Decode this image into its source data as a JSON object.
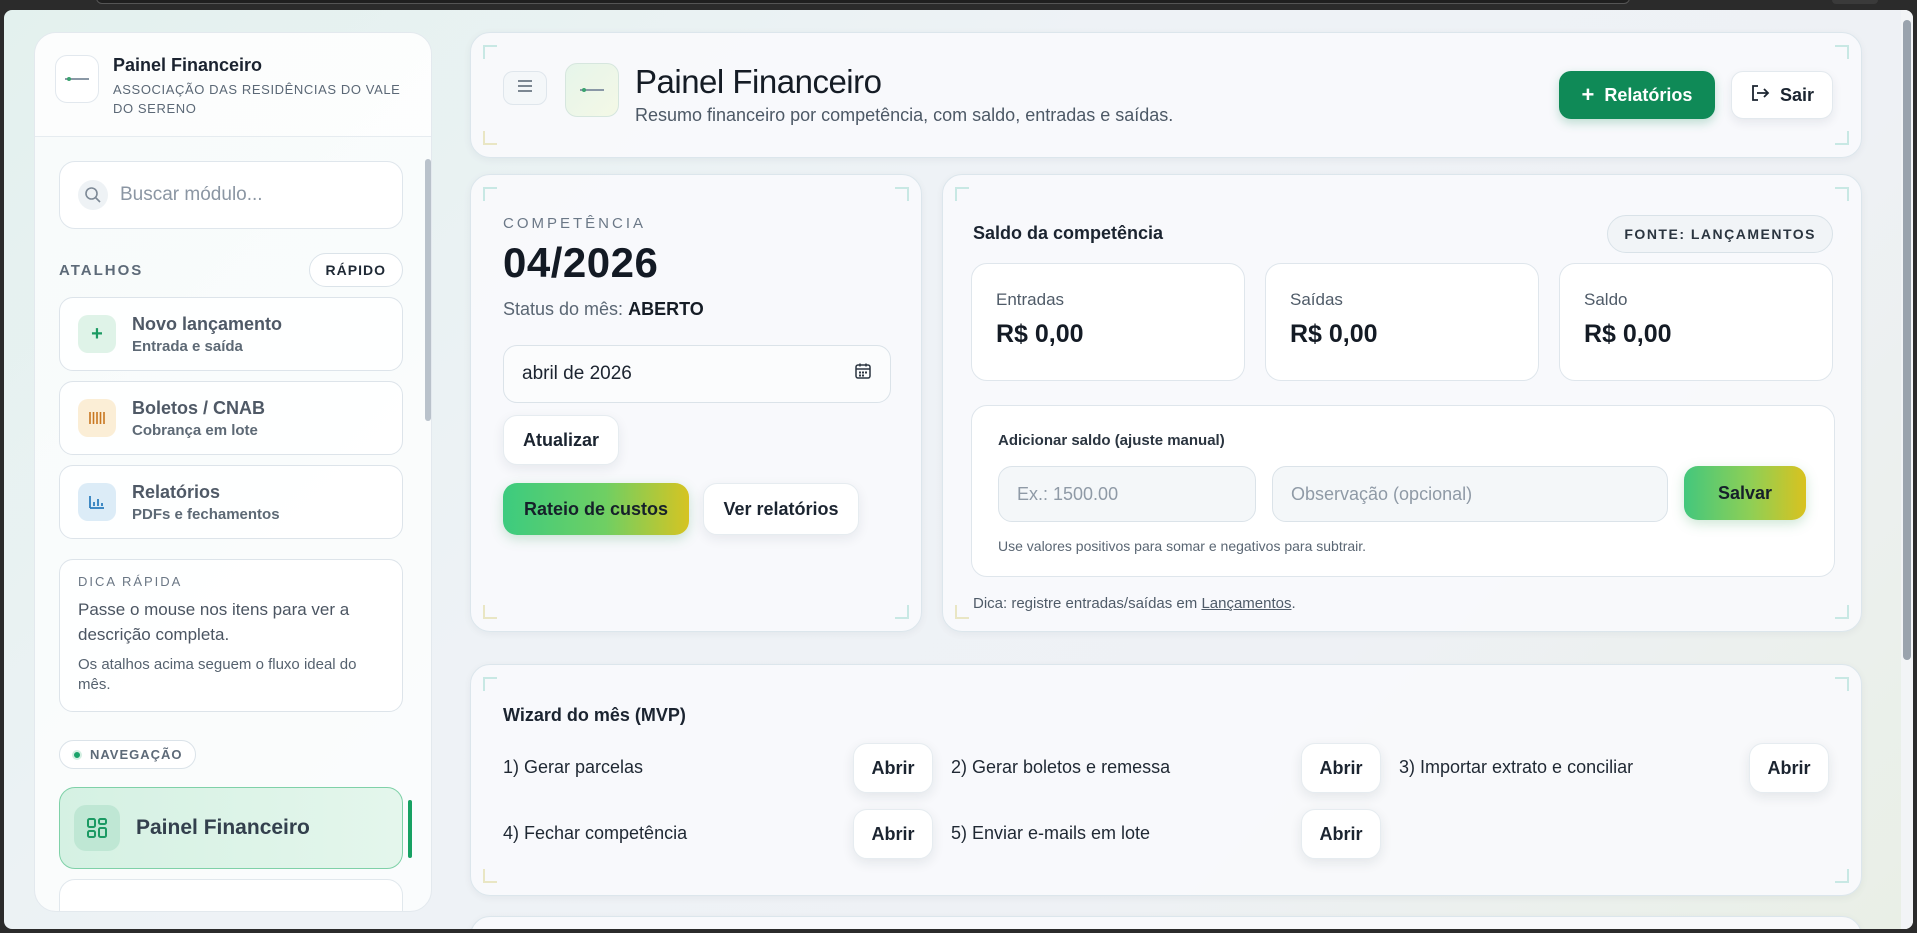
{
  "sidebar": {
    "title": "Painel Financeiro",
    "subtitle": "ASSOCIAÇÃO DAS RESIDÊNCIAS DO VALE DO SERENO",
    "search_placeholder": "Buscar módulo...",
    "shortcuts_label": "ATALHOS",
    "quick_button": "RÁPIDO",
    "shortcuts": [
      {
        "title": "Novo lançamento",
        "subtitle": "Entrada e saída",
        "icon": "plus-icon"
      },
      {
        "title": "Boletos / CNAB",
        "subtitle": "Cobrança em lote",
        "icon": "barcode-icon"
      },
      {
        "title": "Relatórios",
        "subtitle": "PDFs e fechamentos",
        "icon": "bar-chart-icon"
      }
    ],
    "tip": {
      "label": "DICA RÁPIDA",
      "text": "Passe o mouse nos itens para ver a descrição completa.",
      "text2": "Os atalhos acima seguem o fluxo ideal do mês."
    },
    "nav_label": "NAVEGAÇÃO",
    "nav_active": "Painel Financeiro"
  },
  "header": {
    "title": "Painel Financeiro",
    "subtitle": "Resumo financeiro por competência, com saldo, entradas e saídas.",
    "reports_button": "Relatórios",
    "logout_button": "Sair"
  },
  "competencia": {
    "label": "COMPETÊNCIA",
    "value": "04/2026",
    "status_label": "Status do mês:",
    "status_value": "ABERTO",
    "date_value": "abril de 2026",
    "update_button": "Atualizar",
    "rateio_button": "Rateio de custos",
    "reports_button": "Ver relatórios"
  },
  "saldo": {
    "title": "Saldo da competência",
    "source": "FONTE: LANÇAMENTOS",
    "metrics": [
      {
        "label": "Entradas",
        "value": "R$ 0,00"
      },
      {
        "label": "Saídas",
        "value": "R$ 0,00"
      },
      {
        "label": "Saldo",
        "value": "R$ 0,00"
      }
    ],
    "adjust": {
      "title": "Adicionar saldo (ajuste manual)",
      "amount_placeholder": "Ex.: 1500.00",
      "note_placeholder": "Observação (opcional)",
      "save_button": "Salvar",
      "hint": "Use valores positivos para somar e negativos para subtrair."
    },
    "tip_prefix": "Dica: registre entradas/saídas em ",
    "tip_link": "Lançamentos",
    "tip_suffix": "."
  },
  "wizard": {
    "title": "Wizard do mês (MVP)",
    "open_label": "Abrir",
    "steps": [
      "1) Gerar parcelas",
      "2) Gerar boletos e remessa",
      "3) Importar extrato e conciliar",
      "4) Fechar competência",
      "5) Enviar e-mails em lote"
    ]
  },
  "colors": {
    "primary": "#0f8a57",
    "accent_gradient_start": "#3ccb7f",
    "accent_gradient_end": "#d6c422",
    "active_nav_bg": "#d5f1e3"
  }
}
